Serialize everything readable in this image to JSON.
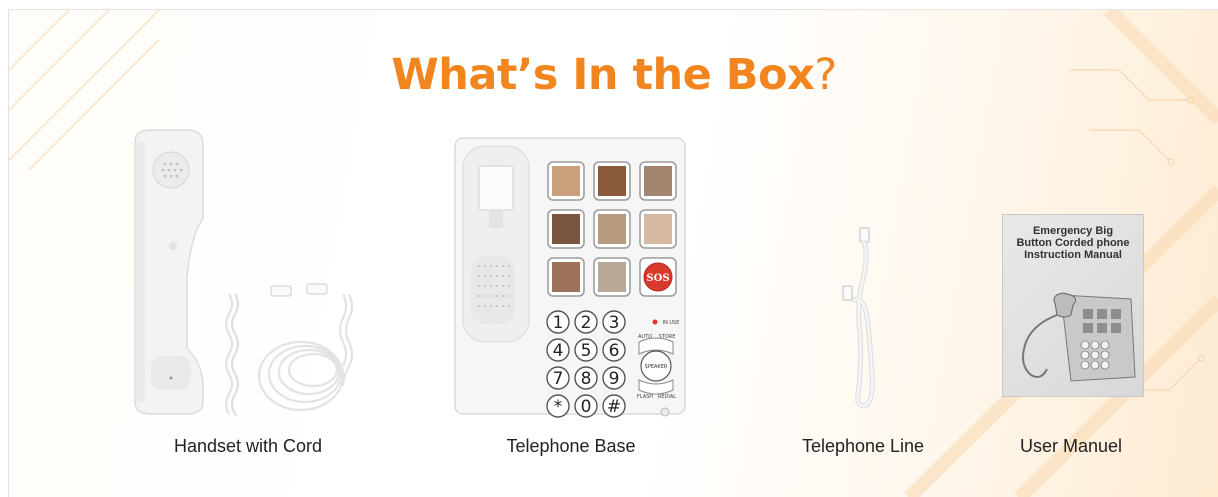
{
  "title": {
    "text": "What’s In the Box",
    "mark": "?"
  },
  "items": [
    {
      "caption": "Handset with Cord",
      "image_name": "handset-with-cord"
    },
    {
      "caption": "Telephone Base",
      "image_name": "telephone-base",
      "keypad": [
        "1",
        "2",
        "3",
        "4",
        "5",
        "6",
        "7",
        "8",
        "9",
        "*",
        "0",
        "#"
      ],
      "sos_label": "SOS",
      "small_labels": {
        "inuse": "IN USE",
        "auto": "AUTO",
        "store": "STORE",
        "speaker": "SPEAKER",
        "flash": "FLASH",
        "redial": "REDIAL"
      }
    },
    {
      "caption": "Telephone Line",
      "image_name": "telephone-line"
    },
    {
      "caption": "User Manuel",
      "image_name": "user-manual",
      "manual_title_lines": [
        "Emergency Big",
        "Button Corded phone",
        "Instruction Manual"
      ]
    }
  ],
  "colors": {
    "accent": "#f2851e",
    "sos": "#d93a2b"
  }
}
